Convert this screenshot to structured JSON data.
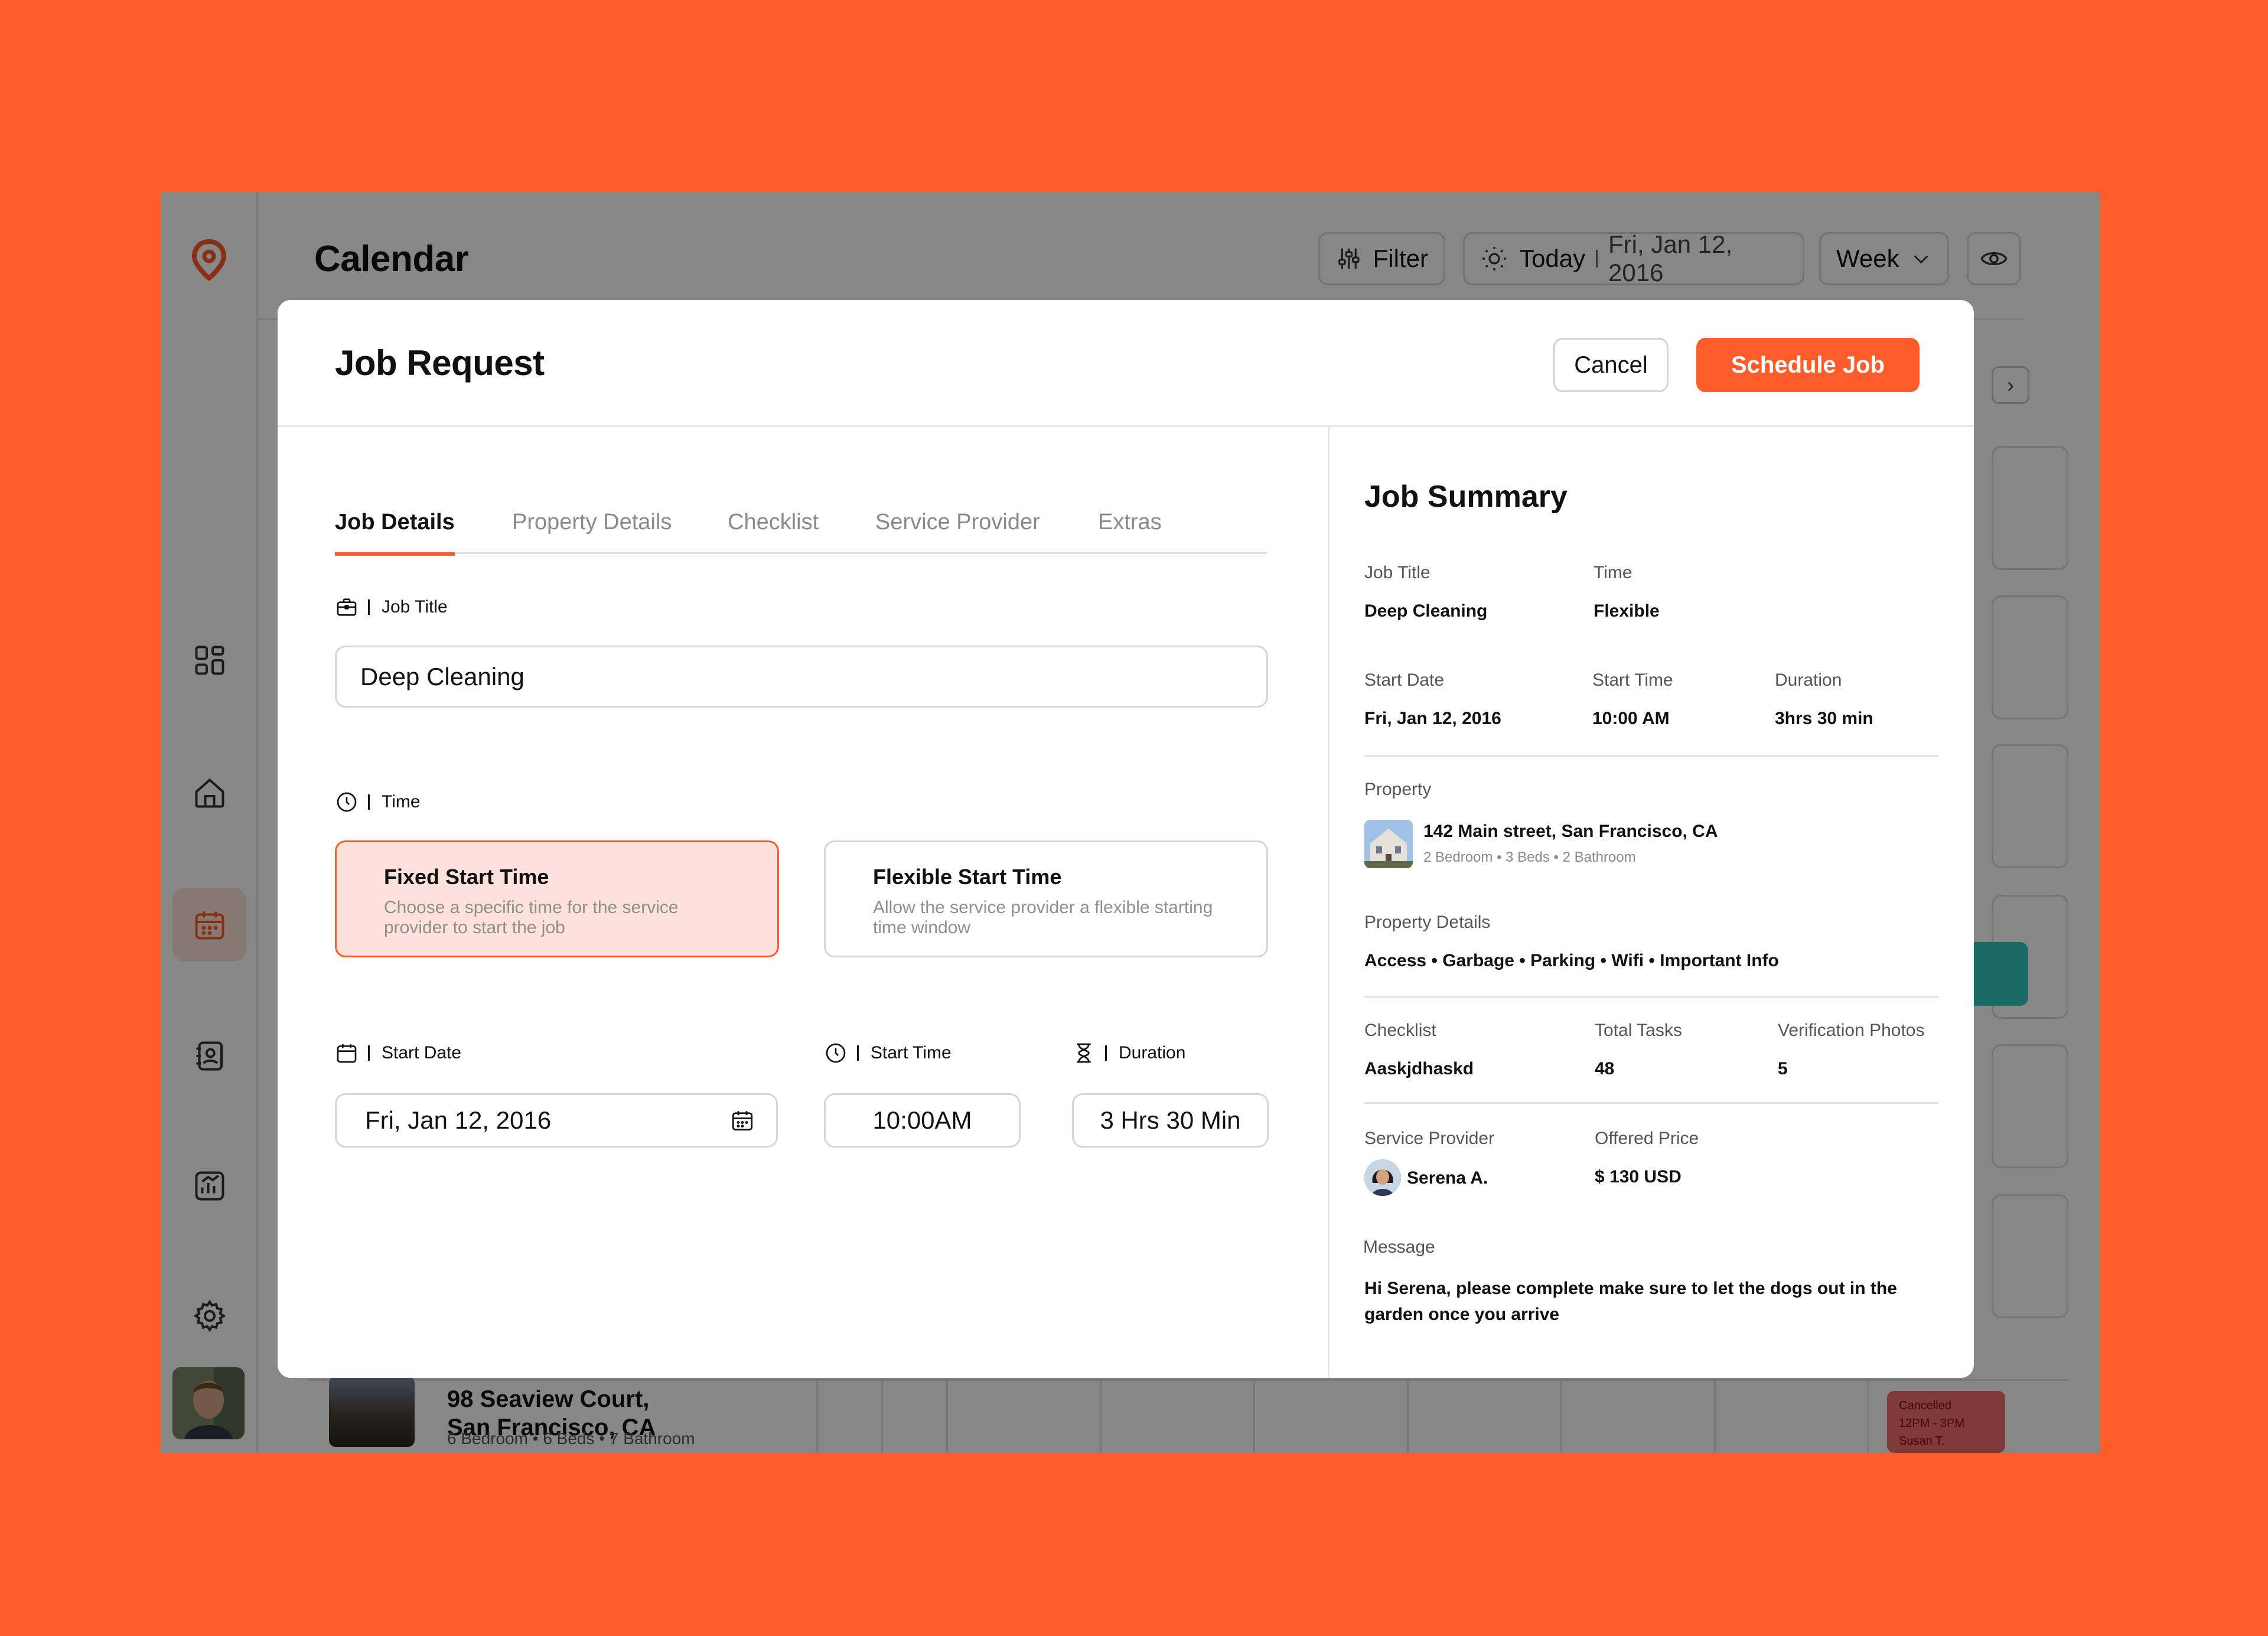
{
  "app": {
    "title": "Calendar",
    "toolbar": {
      "filter_label": "Filter",
      "today_label": "Today",
      "date_label": "Fri, Jan 12, 2016",
      "view_label": "Week"
    },
    "background_listing": {
      "address_line1": "98 Seaview Court,",
      "address_line2": "San Francisco, CA",
      "details": "6 Bedroom • 6 Beds • 7 Bathroom",
      "event": {
        "status": "Cancelled",
        "time": "12PM - 3PM",
        "person": "Susan T."
      }
    }
  },
  "modal": {
    "title": "Job Request",
    "cancel_label": "Cancel",
    "schedule_label": "Schedule Job",
    "tabs": [
      {
        "label": "Job Details",
        "active": true
      },
      {
        "label": "Property Details",
        "active": false
      },
      {
        "label": "Checklist",
        "active": false
      },
      {
        "label": "Service Provider",
        "active": false
      },
      {
        "label": "Extras",
        "active": false
      }
    ],
    "form": {
      "job_title_label": "Job Title",
      "job_title_value": "Deep Cleaning",
      "time_label": "Time",
      "options": [
        {
          "title": "Fixed Start Time",
          "description": "Choose a specific time for the service provider to start the job",
          "selected": true
        },
        {
          "title": "Flexible Start Time",
          "description": "Allow the service provider a flexible starting time window",
          "selected": false
        }
      ],
      "start_date_label": "Start Date",
      "start_date_value": "Fri, Jan 12, 2016",
      "start_time_label": "Start Time",
      "start_time_value": "10:00AM",
      "duration_label": "Duration",
      "duration_value": "3 Hrs 30 Min"
    },
    "summary": {
      "title": "Job Summary",
      "job_title_label": "Job Title",
      "job_title_value": "Deep Cleaning",
      "time_label": "Time",
      "time_value": "Flexible",
      "start_date_label": "Start Date",
      "start_date_value": "Fri, Jan 12, 2016",
      "start_time_label": "Start Time",
      "start_time_value": "10:00 AM",
      "duration_label": "Duration",
      "duration_value": "3hrs 30 min",
      "property_label": "Property",
      "property_address": "142 Main street, San Francisco, CA",
      "property_meta": "2 Bedroom • 3 Beds • 2 Bathroom",
      "property_details_label": "Property Details",
      "property_details_value": "Access • Garbage • Parking • Wifi • Important Info",
      "checklist_label": "Checklist",
      "checklist_value": "Aaskjdhaskd",
      "total_tasks_label": "Total Tasks",
      "total_tasks_value": "48",
      "verification_label": "Verification Photos",
      "verification_value": "5",
      "provider_label": "Service Provider",
      "provider_value": "Serena A.",
      "price_label": "Offered Price",
      "price_value": "$ 130 USD",
      "message_label": "Message",
      "message_value": "Hi Serena, please complete make sure to let the dogs out in the garden once you arrive"
    }
  },
  "colors": {
    "brand": "#FF5C2B",
    "selected_bg": "#FDE1DA",
    "teal": "#35C9C0"
  }
}
